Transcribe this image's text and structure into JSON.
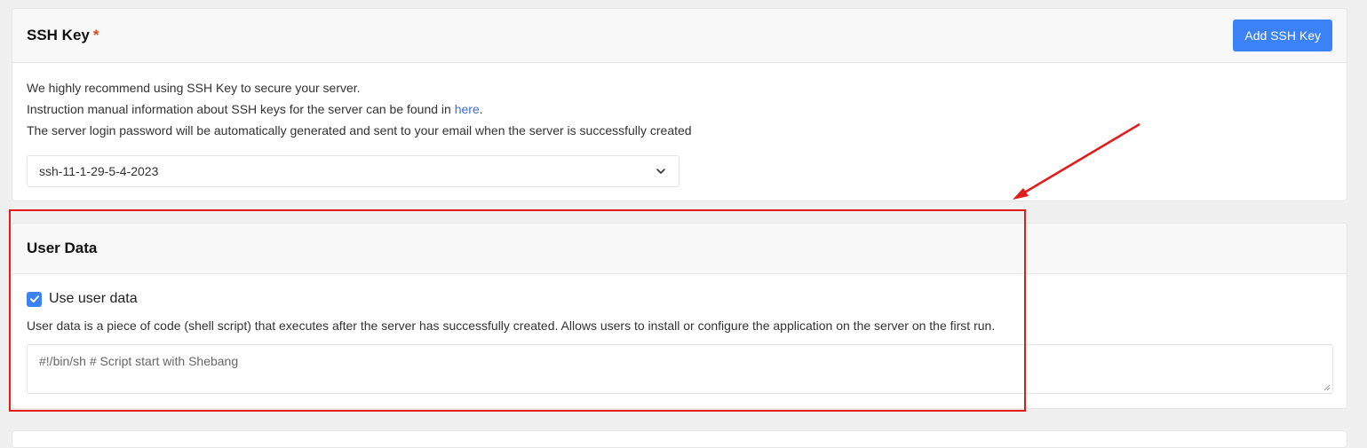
{
  "ssh_section": {
    "title": "SSH Key",
    "required_mark": "*",
    "add_button_label": "Add SSH Key",
    "lines": [
      "We highly recommend using SSH Key to secure your server.",
      "Instruction manual information about SSH keys for the server can be found in ",
      "The server login password will be automatically generated and sent to your email when the server is successfully created"
    ],
    "link_text": "here",
    "link_suffix": ".",
    "selected_key": "ssh-11-1-29-5-4-2023"
  },
  "user_data_section": {
    "title": "User Data",
    "checkbox_label": "Use user data",
    "checkbox_checked": true,
    "description": "User data is a piece of code (shell script) that executes after the server has successfully created. Allows users to install or configure the application on the server on the first run.",
    "textarea_placeholder": "#!/bin/sh # Script start with Shebang"
  },
  "annotation": {
    "highlight_color": "#e21b1b",
    "accent_color": "#3b82f6"
  }
}
